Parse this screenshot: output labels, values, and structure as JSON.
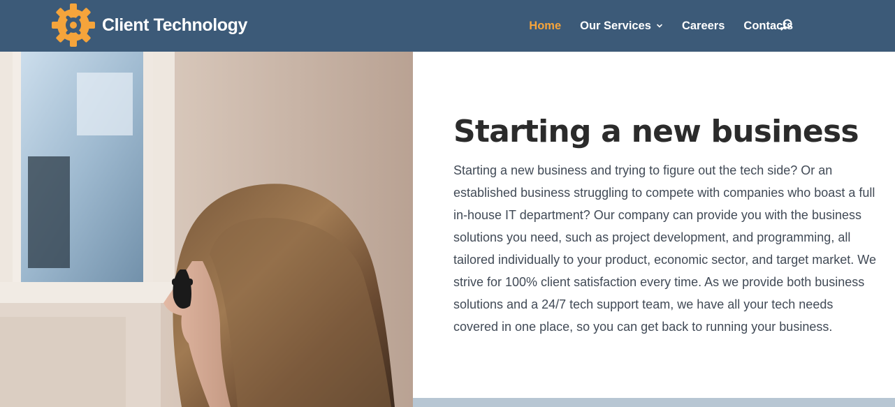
{
  "brand": {
    "name": "Client Technology",
    "logo_icon": "gear-wrench-icon",
    "accent_color": "#f5a43b",
    "header_color": "#3c5a78"
  },
  "nav": {
    "items": [
      {
        "label": "Home",
        "active": true
      },
      {
        "label": "Our Services",
        "has_dropdown": true
      },
      {
        "label": "Careers"
      },
      {
        "label": "Contacts"
      }
    ],
    "search_icon": "search-icon"
  },
  "hero": {
    "image_description_icon": "woman-photo",
    "title": "Starting a new business",
    "body": "Starting a new business and trying to figure out the tech side? Or an established business struggling to compete with companies who boast a full in-house IT department? Our company can provide you with the business solutions you need, such as project development, and programming, all tailored individually to your product, economic sector, and target market. We strive for 100% client satisfaction every time. As we provide both business solutions and a 24/7 tech support team, we have all your tech needs covered in one place, so you can get back to running your business."
  }
}
